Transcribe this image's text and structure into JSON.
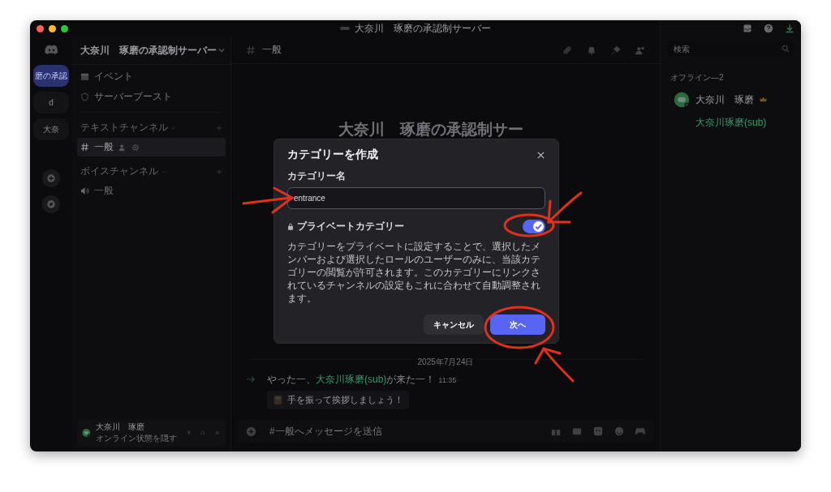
{
  "window": {
    "title": "大奈川　琢磨の承認制サーバー"
  },
  "server_rail": [
    {
      "label": "磨の承認",
      "selected": true
    },
    {
      "label": "d",
      "selected": false
    },
    {
      "label": "大奈",
      "selected": false
    }
  ],
  "sidebar": {
    "server_name": "大奈川　琢磨の承認制サーバー",
    "items": [
      "イベント",
      "サーバーブースト"
    ],
    "categories": [
      {
        "name": "テキストチャンネル",
        "channels": [
          {
            "name": "一般",
            "kind": "text",
            "selected": true
          }
        ]
      },
      {
        "name": "ボイスチャンネル",
        "channels": [
          {
            "name": "一般",
            "kind": "voice",
            "selected": false
          }
        ]
      }
    ]
  },
  "user_panel": {
    "name": "大奈川　琢磨",
    "status": "オンライン状態を隠す"
  },
  "header": {
    "channel": "一般"
  },
  "welcome_title": "大奈川　琢磨の承認制サー",
  "date_divider": "2025年7月24日",
  "message": {
    "before": "やった一、",
    "mention": "大奈川琢磨(sub)",
    "after": "が来た一！",
    "time": "11:35",
    "wave_button": "手を振って挨拶しましょう！"
  },
  "composer": {
    "placeholder": "#一般へメッセージを送信"
  },
  "members": {
    "search_placeholder": "検索",
    "group": "オフライン—2",
    "list": [
      {
        "name": "大奈川　琢磨",
        "owner": true,
        "color": "#9a9ba0"
      },
      {
        "name": "大奈川琢磨(sub)",
        "owner": false,
        "color": "#3a9a6e"
      }
    ]
  },
  "modal": {
    "title": "カテゴリーを作成",
    "field_label": "カテゴリー名",
    "value": "entrance",
    "private": {
      "label": "プライベートカテゴリー",
      "on": true
    },
    "description": "カテゴリーをプライベートに設定することで、選択したメンバーおよび選択したロールのユーザーのみに、当該カテゴリーの閲覧が許可されます。このカテゴリーにリンクされているチャンネルの設定もこれに合わせて自動調整されます。",
    "cancel": "キャンセル",
    "next": "次へ"
  }
}
